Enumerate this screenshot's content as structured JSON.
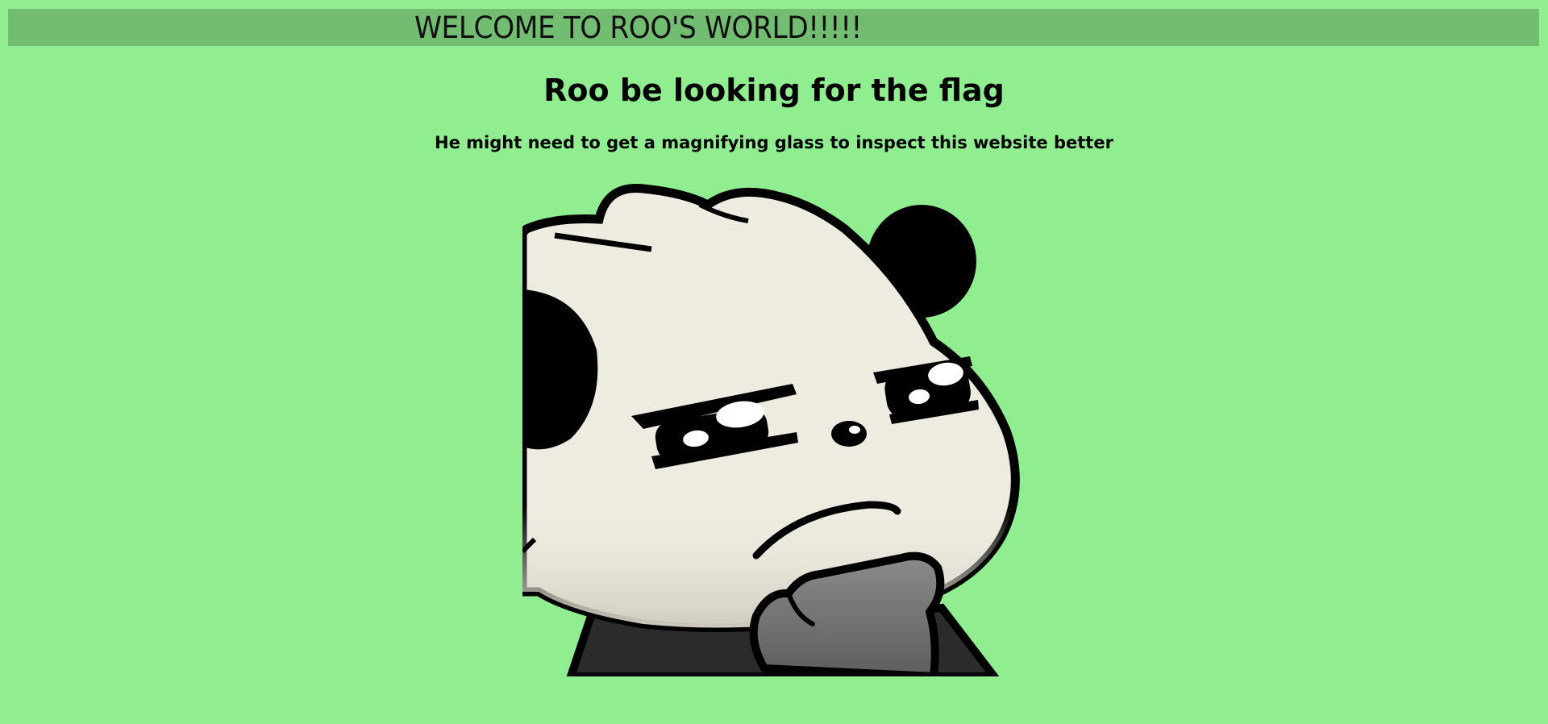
{
  "banner": {
    "text": "WELCOME TO ROO'S WORLD!!!!!"
  },
  "main": {
    "heading": "Roo be looking for the flag",
    "subheading": "He might need to get a magnifying glass to inspect this website better"
  },
  "image": {
    "icon": "thinking-panda-roo-image"
  },
  "colors": {
    "background": "#90ee90",
    "banner": "#73bd73"
  }
}
